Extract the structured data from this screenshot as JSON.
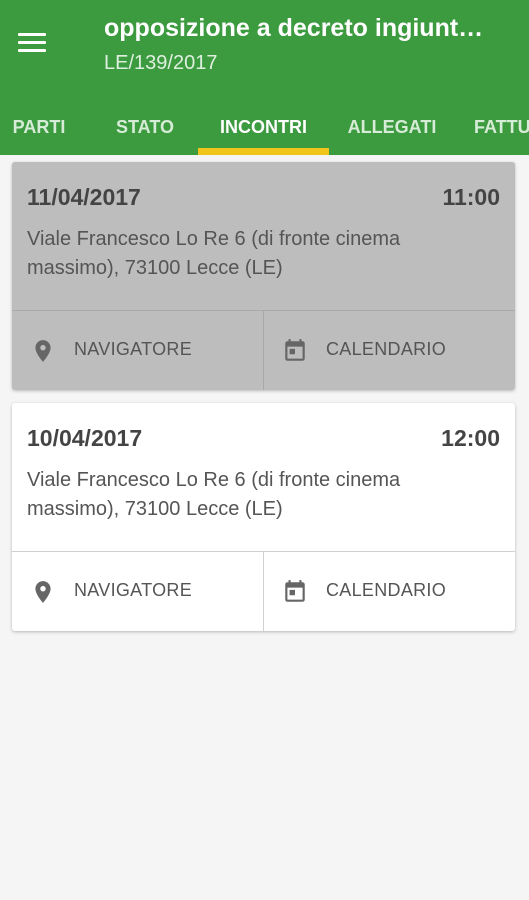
{
  "app_bar": {
    "title": "opposizione a decreto ingiunt…",
    "subtitle": "LE/139/2017"
  },
  "tabs": [
    {
      "label": "PARTI"
    },
    {
      "label": "STATO"
    },
    {
      "label": "INCONTRI",
      "active": true
    },
    {
      "label": "ALLEGATI"
    },
    {
      "label": "FATTU"
    }
  ],
  "colors": {
    "primary": "#3c9a3f",
    "tab_indicator": "#f2c51c",
    "selected_card": "#bdbdbd"
  },
  "meetings": [
    {
      "date": "11/04/2017",
      "time": "11:00",
      "address": "Viale Francesco Lo Re 6 (di fronte cinema massimo), 73100 Lecce (LE)",
      "navigator_label": "NAVIGATORE",
      "calendar_label": "CALENDARIO",
      "selected": true
    },
    {
      "date": "10/04/2017",
      "time": "12:00",
      "address": "Viale Francesco Lo Re 6 (di fronte cinema massimo), 73100 Lecce (LE)",
      "navigator_label": "NAVIGATORE",
      "calendar_label": "CALENDARIO",
      "selected": false
    }
  ],
  "icons": {
    "menu": "menu-icon",
    "navigator": "location-pin-icon",
    "calendar": "calendar-icon"
  }
}
